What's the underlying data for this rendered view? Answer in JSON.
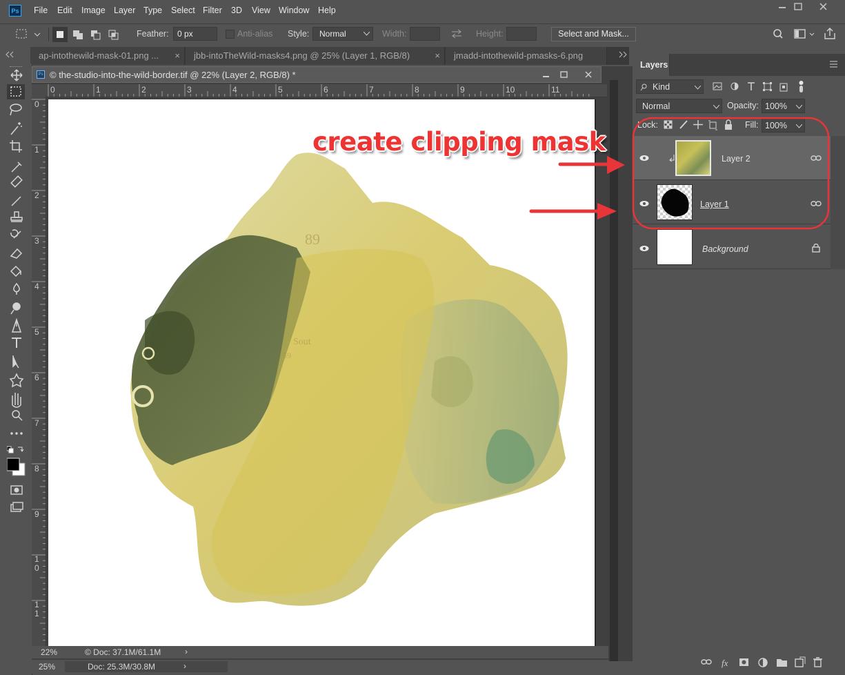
{
  "app": {
    "logo": "Ps"
  },
  "menu": [
    "File",
    "Edit",
    "Image",
    "Layer",
    "Type",
    "Select",
    "Filter",
    "3D",
    "View",
    "Window",
    "Help"
  ],
  "options": {
    "feather_label": "Feather:",
    "feather_value": "0 px",
    "antialias_label": "Anti-alias",
    "style_label": "Style:",
    "style_value": "Normal",
    "width_label": "Width:",
    "height_label": "Height:",
    "select_mask": "Select and Mask..."
  },
  "tabs": [
    {
      "label": "ap-intothewild-mask-01.png ...",
      "close": "×"
    },
    {
      "label": "jbb-intoTheWild-masks4.png @ 25% (Layer 1, RGB/8)",
      "close": "×"
    },
    {
      "label": "jmadd-intothewild-pmasks-6.png"
    }
  ],
  "document": {
    "title": "© the-studio-into-the-wild-border.tif @ 22% (Layer 2, RGB/8) *",
    "ruler_top": [
      "0",
      "1",
      "2",
      "3",
      "4",
      "5",
      "6",
      "7",
      "8",
      "9",
      "10",
      "11"
    ],
    "ruler_left": [
      "0",
      "1",
      "2",
      "3",
      "4",
      "5",
      "6",
      "7",
      "8",
      "9",
      "1\n0",
      "1\n1"
    ]
  },
  "status": {
    "zoom1": "22%",
    "doc1": "© Doc: 37.1M/61.1M",
    "zoom2": "25%",
    "doc2": "Doc: 25.3M/30.8M"
  },
  "layers_panel": {
    "title": "Layers",
    "filter_kind": "Kind",
    "blend_mode": "Normal",
    "opacity_label": "Opacity:",
    "opacity_value": "100%",
    "lock_label": "Lock:",
    "fill_label": "Fill:",
    "fill_value": "100%",
    "layers": [
      {
        "name": "Layer 2"
      },
      {
        "name": "Layer 1"
      },
      {
        "name": "Background"
      }
    ]
  },
  "annotation": {
    "text": "create clipping mask"
  },
  "colors": {
    "annotation_red": "#e8353a",
    "panel_bg": "#535353",
    "selected_layer": "#666666"
  }
}
